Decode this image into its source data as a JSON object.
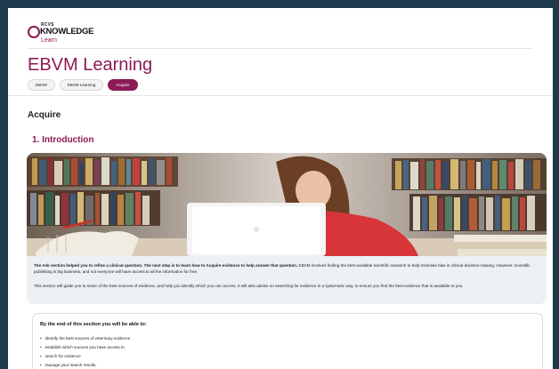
{
  "brand": {
    "top": "RCVS",
    "word": "KNOWLEDGE",
    "sub": "Learn"
  },
  "page": {
    "title": "EBVM Learning"
  },
  "breadcrumb": [
    {
      "label": "EBVM"
    },
    {
      "label": "EBVM Learning"
    },
    {
      "label": "Acquire"
    }
  ],
  "section": {
    "title": "Acquire",
    "heading": "1. Introduction"
  },
  "intro": {
    "p1_bold": "The Ask section helped you to refine a clinical question. The next step is to learn how to Acquire evidence to help answer that question.",
    "p1_rest": " EBVM involves finding the best available scientific research to help minimise bias in clinical decision-making. However, scientific publishing is big business, and not everyone will have access to all the information for free.",
    "p2": "This section will guide you to some of the best sources of evidence, and help you identify which you can access. It will also advise on searching for evidence in a systematic way, to ensure you find the best evidence that is available to you."
  },
  "outcomes": {
    "title": "By the end of this section you will be able to:",
    "items": [
      "identify the best sources of veterinary evidence",
      "establish which sources you have access to",
      "search for evidence",
      "manage your search results."
    ]
  },
  "colors": {
    "accent": "#8c1a55",
    "frame": "#1e3a4c",
    "card": "#ecf1f5"
  }
}
